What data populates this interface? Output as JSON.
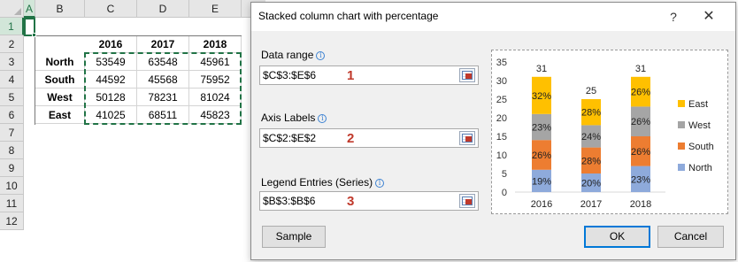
{
  "sheet": {
    "columns": [
      "A",
      "B",
      "C",
      "D",
      "E"
    ],
    "rows": [
      "1",
      "2",
      "3",
      "4",
      "5",
      "6",
      "7",
      "8",
      "9",
      "10",
      "11",
      "12"
    ],
    "years": [
      "2016",
      "2017",
      "2018"
    ],
    "regions": [
      "North",
      "South",
      "West",
      "East"
    ],
    "values": [
      [
        "53549",
        "63548",
        "45961"
      ],
      [
        "44592",
        "45568",
        "75952"
      ],
      [
        "50128",
        "78231",
        "81024"
      ],
      [
        "41025",
        "68511",
        "45823"
      ]
    ]
  },
  "dialog": {
    "title": "Stacked column chart with percentage",
    "help": "?",
    "close": "✕",
    "fields": [
      {
        "label": "Data range",
        "value": "$C$3:$E$6",
        "badge": "1"
      },
      {
        "label": "Axis Labels",
        "value": "$C$2:$E$2",
        "badge": "2"
      },
      {
        "label": "Legend Entries (Series)",
        "value": "$B$3:$B$6",
        "badge": "3"
      }
    ],
    "info_icon": "i",
    "sample_button": "Sample",
    "ok_button": "OK",
    "cancel_button": "Cancel"
  },
  "chart_data": {
    "type": "bar",
    "stacked": true,
    "categories": [
      "2016",
      "2017",
      "2018"
    ],
    "series": [
      {
        "name": "North",
        "color": "#8eaadb",
        "values": [
          6,
          5,
          7
        ],
        "labels": [
          "19%",
          "20%",
          "23%"
        ]
      },
      {
        "name": "South",
        "color": "#ed7d31",
        "values": [
          8,
          7,
          8
        ],
        "labels": [
          "26%",
          "28%",
          "26%"
        ]
      },
      {
        "name": "West",
        "color": "#a5a5a5",
        "values": [
          7,
          6,
          8
        ],
        "labels": [
          "23%",
          "24%",
          "26%"
        ]
      },
      {
        "name": "East",
        "color": "#ffc000",
        "values": [
          10,
          7,
          8
        ],
        "labels": [
          "32%",
          "28%",
          "26%"
        ]
      }
    ],
    "totals": [
      "31",
      "25",
      "31"
    ],
    "ylim": [
      0,
      35
    ],
    "yticks": [
      "0",
      "5",
      "10",
      "15",
      "20",
      "25",
      "30",
      "35"
    ],
    "legend_position": "right",
    "legend_order": [
      "East",
      "West",
      "South",
      "North"
    ],
    "grid": false
  }
}
